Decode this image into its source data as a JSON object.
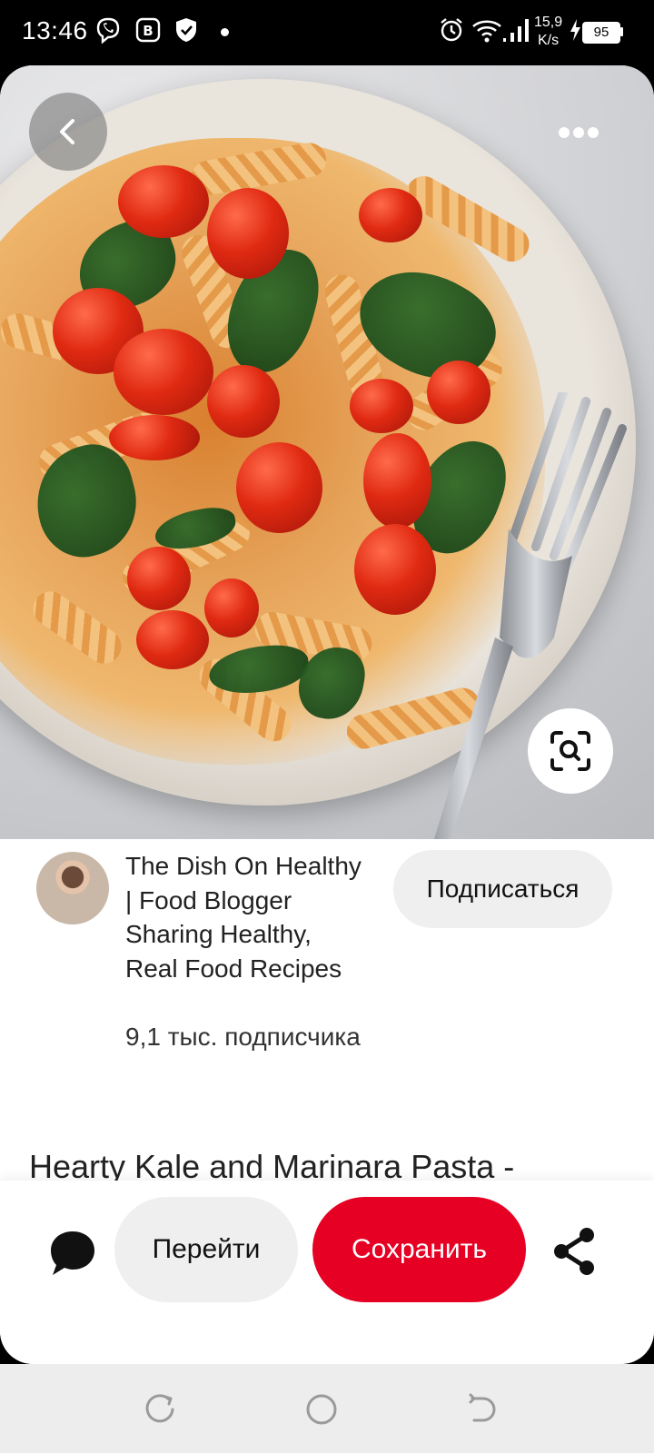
{
  "status_bar": {
    "time": "13:46",
    "net_speed_value": "15,9",
    "net_speed_unit": "K/s",
    "battery": "95",
    "icons": [
      "viber-icon",
      "bitcoin-icon",
      "shield-icon",
      "dot-icon",
      "alarm-icon",
      "wifi-icon",
      "signal-icon",
      "charging-icon",
      "battery-icon"
    ]
  },
  "photo": {
    "icons": {
      "back": "back-arrow-icon",
      "more": "more-dots-icon",
      "lens": "visual-search-icon"
    }
  },
  "creator": {
    "name": "The Dish On Healthy | Food Blogger Sharing Healthy, Real Food Recipes",
    "followers": "9,1 тыс. подписчика",
    "subscribe_label": "Подписаться"
  },
  "pin": {
    "title": "Hearty Kale and Marinara Pasta -"
  },
  "actions": {
    "visit_label": "Перейти",
    "save_label": "Сохранить",
    "icons": {
      "comment": "comment-icon",
      "share": "share-icon"
    }
  },
  "colors": {
    "save_button": "#e60023",
    "neutral_button": "#efefef",
    "nav_bar": "#ededed"
  },
  "nav_bar": {
    "icons": [
      "recent-apps-icon",
      "home-icon",
      "back-icon"
    ]
  }
}
